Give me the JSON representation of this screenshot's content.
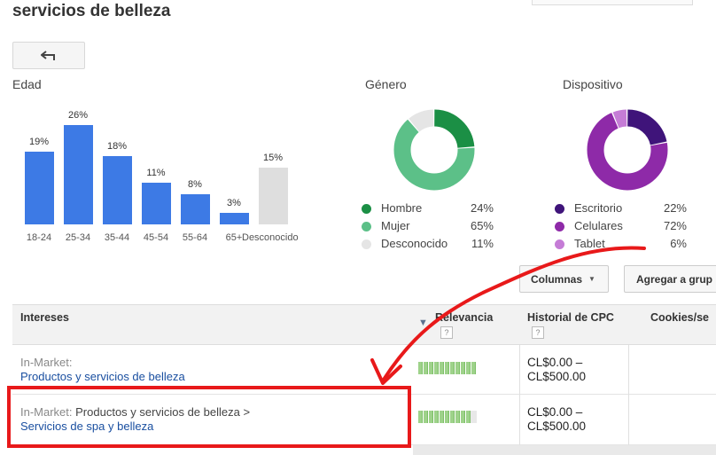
{
  "page": {
    "title": "servicios de belleza"
  },
  "colors": {
    "bar": "#3d7ae5",
    "bar_unknown": "#dedede",
    "male": "#1b8f45",
    "female": "#5cc088",
    "unknown": "#e5e5e5",
    "desktop": "#3f147a",
    "mobile": "#8e2aa8",
    "tablet": "#c57cd6",
    "highlight": "#e8191a"
  },
  "age": {
    "label": "Edad",
    "chart_data": {
      "type": "bar",
      "categories": [
        "18-24",
        "25-34",
        "35-44",
        "45-54",
        "55-64",
        "65+",
        "Desconocido"
      ],
      "values": [
        19,
        26,
        18,
        11,
        8,
        3,
        15
      ],
      "labels": [
        "19%",
        "26%",
        "18%",
        "11%",
        "8%",
        "3%",
        "15%"
      ]
    }
  },
  "gender": {
    "label": "Género",
    "chart_data": {
      "type": "pie",
      "donut": true,
      "slices": [
        {
          "name": "Hombre",
          "value": 24,
          "label": "24%",
          "color": "#1b8f45"
        },
        {
          "name": "Mujer",
          "value": 65,
          "label": "65%",
          "color": "#5cc088"
        },
        {
          "name": "Desconocido",
          "value": 11,
          "label": "11%",
          "color": "#e5e5e5"
        }
      ]
    }
  },
  "device": {
    "label": "Dispositivo",
    "chart_data": {
      "type": "pie",
      "donut": true,
      "slices": [
        {
          "name": "Escritorio",
          "value": 22,
          "label": "22%",
          "color": "#3f147a"
        },
        {
          "name": "Celulares",
          "value": 72,
          "label": "72%",
          "color": "#8e2aa8"
        },
        {
          "name": "Tablet",
          "value": 6,
          "label": "6%",
          "color": "#c57cd6"
        }
      ]
    }
  },
  "toolbar": {
    "columns_label": "Columnas",
    "add_group_label": "Agregar a grup"
  },
  "table": {
    "headers": {
      "interests": "Intereses",
      "relevance": "Relevancia",
      "cpc_history": "Historial de CPC",
      "cookies": "Cookies/se",
      "help": "?"
    },
    "rows": [
      {
        "prefix": "In-Market:",
        "path": "",
        "link": "Productos y servicios de belleza",
        "relevance": 1.0,
        "cpc_line1": "CL$0.00 –",
        "cpc_line2": "CL$500.00"
      },
      {
        "prefix": "In-Market:",
        "path": "Productos y servicios de belleza >",
        "link": "Servicios de spa y belleza",
        "relevance": 0.9,
        "cpc_line1": "CL$0.00 –",
        "cpc_line2": "CL$500.00"
      }
    ]
  }
}
